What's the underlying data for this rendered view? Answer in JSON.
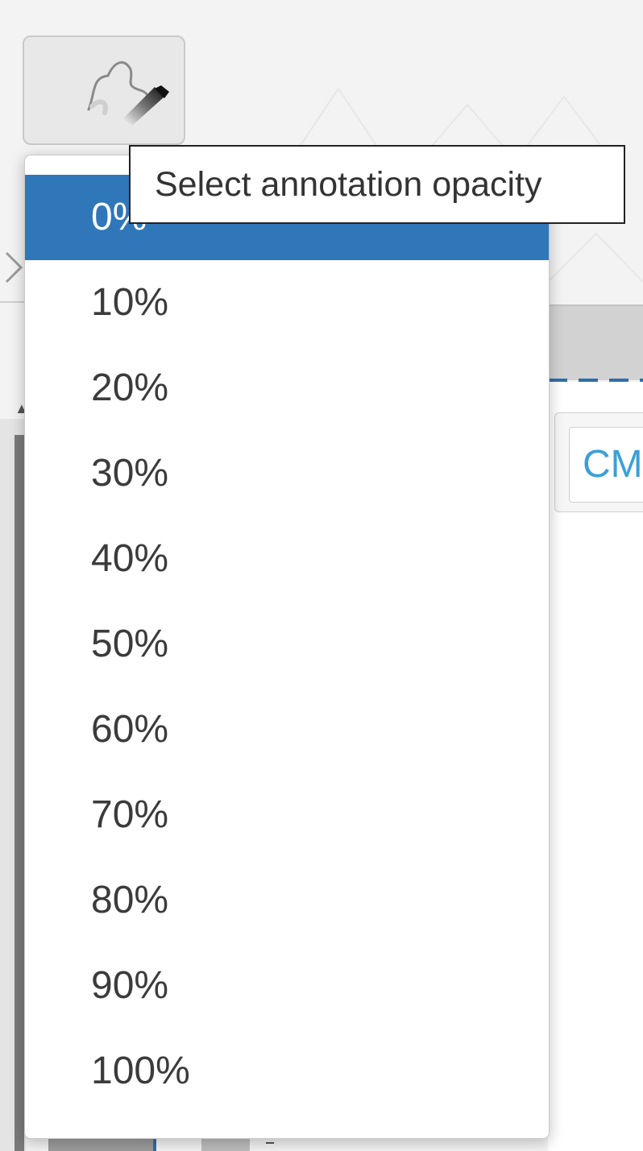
{
  "toolbar": {
    "annotation_tool_icon": "pen-brush-icon"
  },
  "tooltip": {
    "text": "Select annotation opacity"
  },
  "opacity_dropdown": {
    "selected_index": 0,
    "options": [
      "0%",
      "10%",
      "20%",
      "30%",
      "40%",
      "50%",
      "60%",
      "70%",
      "80%",
      "90%",
      "100%"
    ]
  },
  "background": {
    "cm_label": "CM"
  },
  "colors": {
    "selected_bg": "#2f77b9",
    "accent_link": "#3aa0d9",
    "dashed_border": "#2f6eab"
  }
}
